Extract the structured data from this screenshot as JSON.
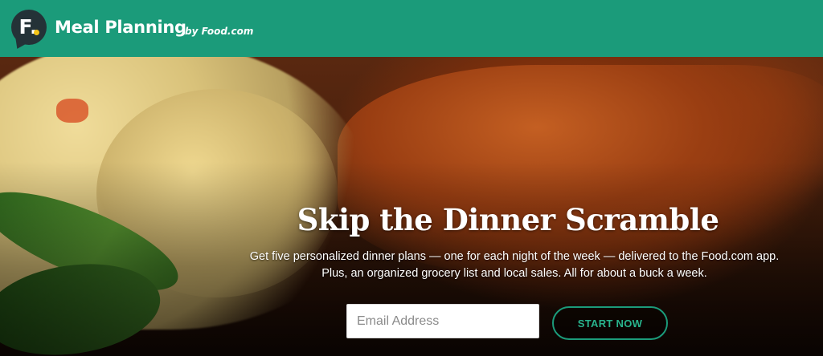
{
  "header": {
    "logo_letter": "F.",
    "brand_name": "Meal Planning",
    "brand_byline": "by Food.com",
    "background_color": "#1b9b7a"
  },
  "hero": {
    "headline": "Skip the Dinner Scramble",
    "subtext_line1": "Get five personalized dinner plans — one for each night of the week — delivered to the Food.com app.",
    "subtext_line2": "Plus, an organized grocery list and local sales. All for about a buck a week.",
    "background_image": "glazed-pork-chop-with-couscous"
  },
  "signup": {
    "email_placeholder": "Email Address",
    "email_value": "",
    "start_button_label": "START NOW",
    "accent_color": "#1b9b7a"
  }
}
